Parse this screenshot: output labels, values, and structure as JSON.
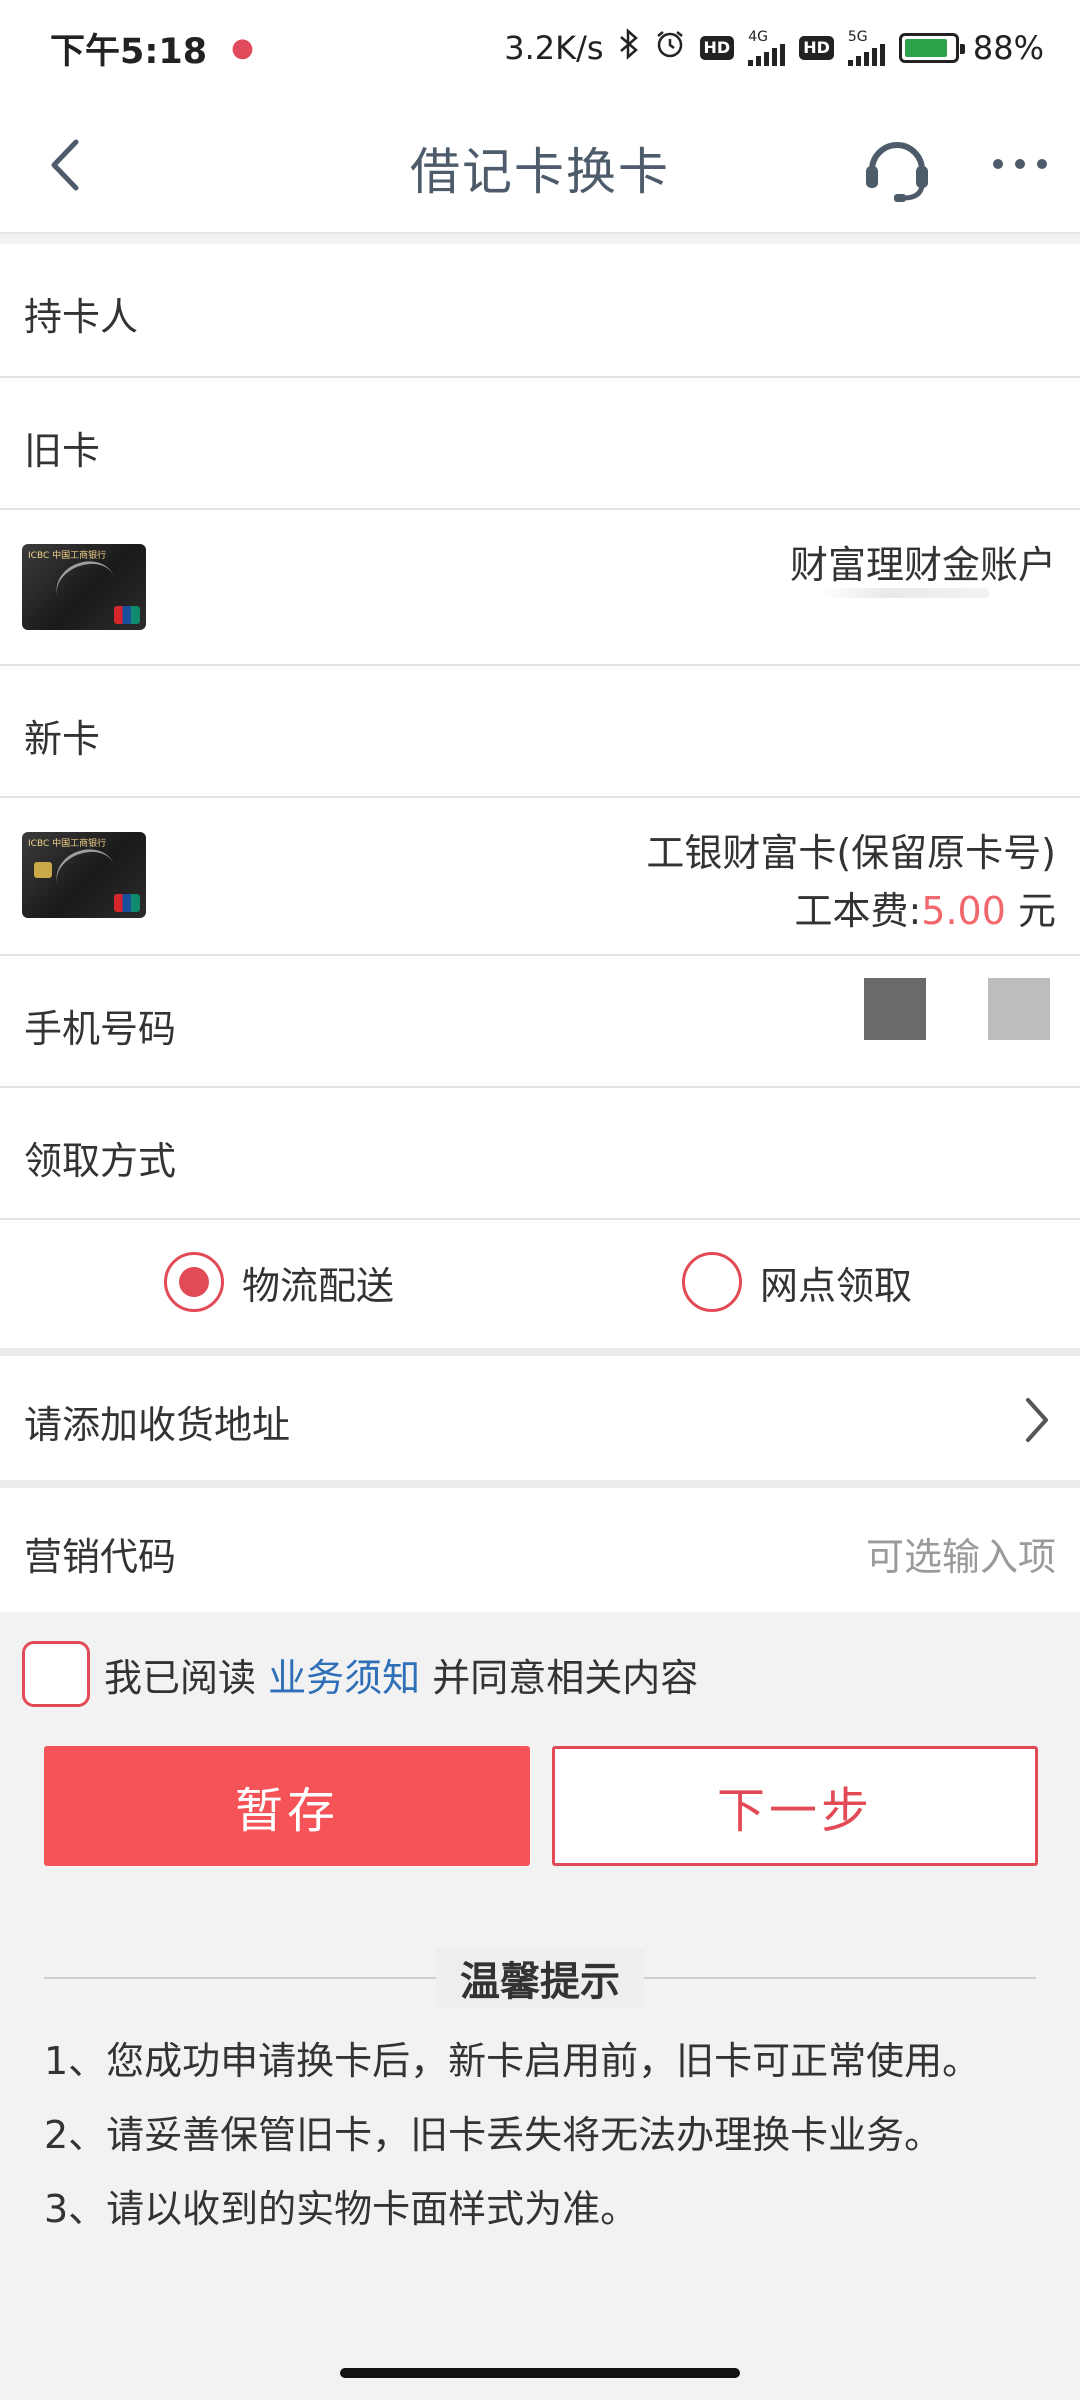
{
  "status_bar": {
    "time": "下午5:18",
    "net_speed": "3.2K/s",
    "hd1": "HD",
    "net1": "4G",
    "hd2": "HD",
    "net2": "5G",
    "battery": "88%",
    "battery_level": 0.88
  },
  "nav": {
    "title": "借记卡换卡",
    "back_icon": "chevron-left-icon",
    "service_icon": "headset-icon",
    "more_icon": "more-dots-icon"
  },
  "form": {
    "holder_label": "持卡人",
    "old_card_label": "旧卡",
    "old_card_name": "财富理财金账户",
    "new_card_label": "新卡",
    "new_card_name": "工银财富卡(保留原卡号)",
    "fee_prefix": "工本费:",
    "fee_value": "5.00",
    "fee_unit": "元",
    "phone_label": "手机号码",
    "pickup_label": "领取方式",
    "pickup_options": [
      {
        "label": "物流配送",
        "selected": true
      },
      {
        "label": "网点领取",
        "selected": false
      }
    ],
    "address_label": "请添加收货地址",
    "marketing_label": "营销代码",
    "marketing_placeholder": "可选输入项"
  },
  "agreement": {
    "prefix": "我已阅读",
    "link": "业务须知",
    "suffix": "并同意相关内容"
  },
  "buttons": {
    "save": "暂存",
    "next": "下一步"
  },
  "tips": {
    "title": "温馨提示",
    "items": [
      "1、您成功申请换卡后，新卡启用前，旧卡可正常使用。",
      "2、请妥善保管旧卡，旧卡丢失将无法办理换卡业务。",
      "3、请以收到的实物卡面样式为准。"
    ]
  },
  "colors": {
    "accent": "#e24b55",
    "save_button": "#f55357",
    "link": "#2f6fb8",
    "title": "#4d5b6a",
    "background": "#f2f2f2"
  }
}
